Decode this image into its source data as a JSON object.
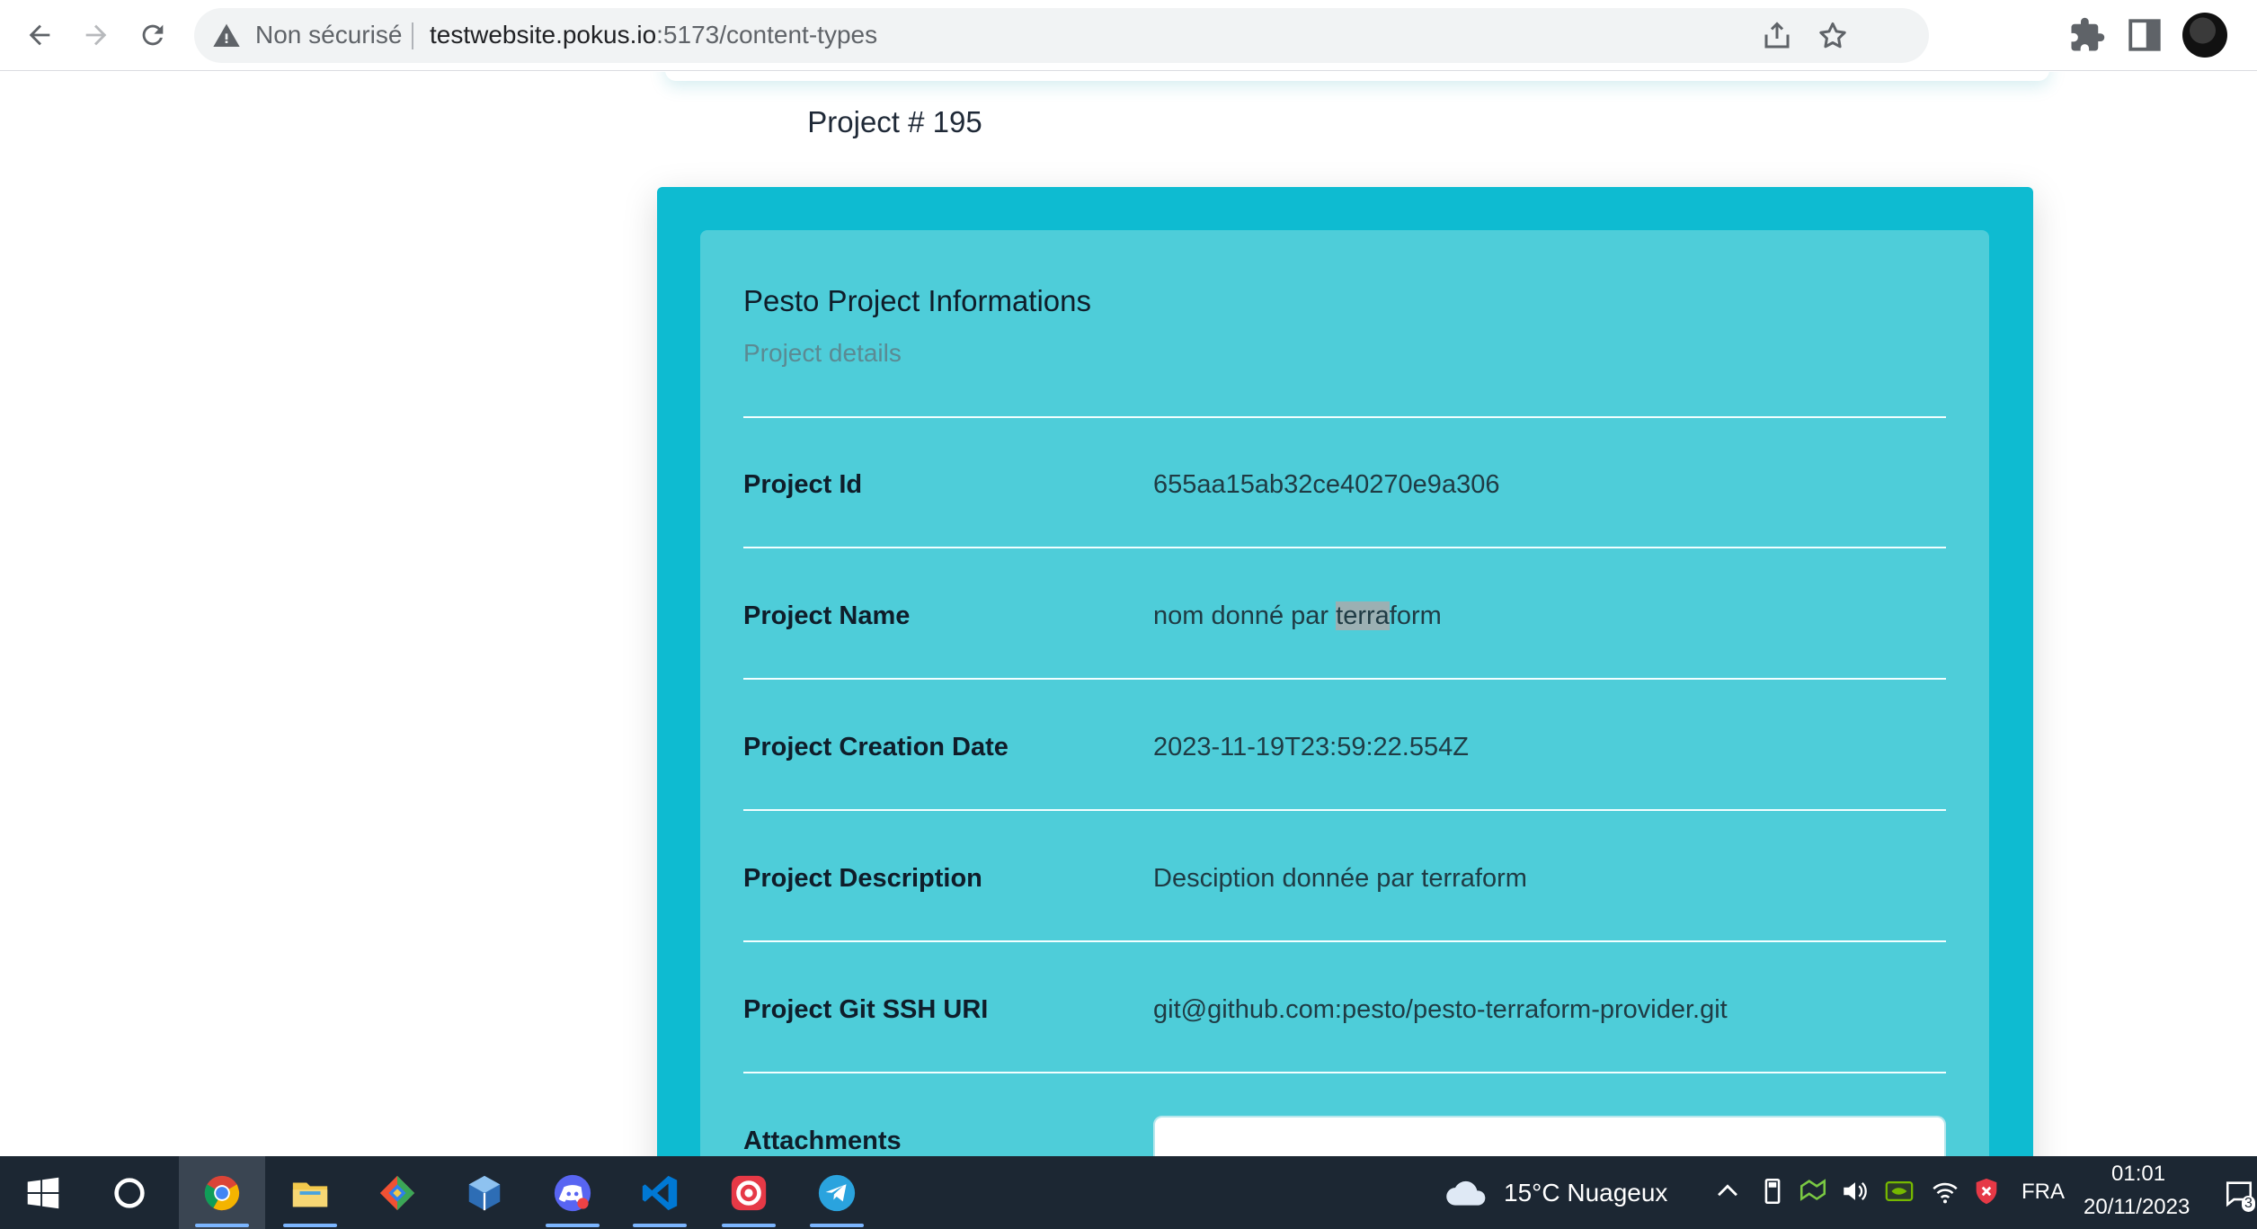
{
  "browser": {
    "security_label": "Non sécurisé",
    "url_host": "testwebsite.pokus.io",
    "url_path": ":5173/content-types"
  },
  "page": {
    "title": "Project # 195"
  },
  "project_card": {
    "title": "Pesto Project Informations",
    "subtitle": "Project details",
    "rows": [
      {
        "label": "Project Id",
        "value": "655aa15ab32ce40270e9a306"
      },
      {
        "label": "Project Name",
        "value_before": "nom donné par ",
        "value_selected": "terra",
        "value_after": "form"
      },
      {
        "label": "Project Creation Date",
        "value": "2023-11-19T23:59:22.554Z"
      },
      {
        "label": "Project Description",
        "value": "Desciption donnée par terraform"
      },
      {
        "label": "Project Git SSH URI",
        "value": "git@github.com:pesto/pesto-terraform-provider.git"
      },
      {
        "label": "Attachments"
      }
    ]
  },
  "taskbar": {
    "apps": [
      "windows-start",
      "cortana-search",
      "chrome",
      "file-explorer",
      "git-app",
      "virtualbox",
      "discord",
      "vscode",
      "debugger-app",
      "telegram"
    ],
    "weather": "15°C  Nuageux",
    "language": "FRA",
    "time": "01:01",
    "date": "20/11/2023",
    "notification_count": "3"
  },
  "colors": {
    "card_outer": "#0ebbd1",
    "card_inner": "#4ecdd9",
    "taskbar": "#1c2733"
  }
}
